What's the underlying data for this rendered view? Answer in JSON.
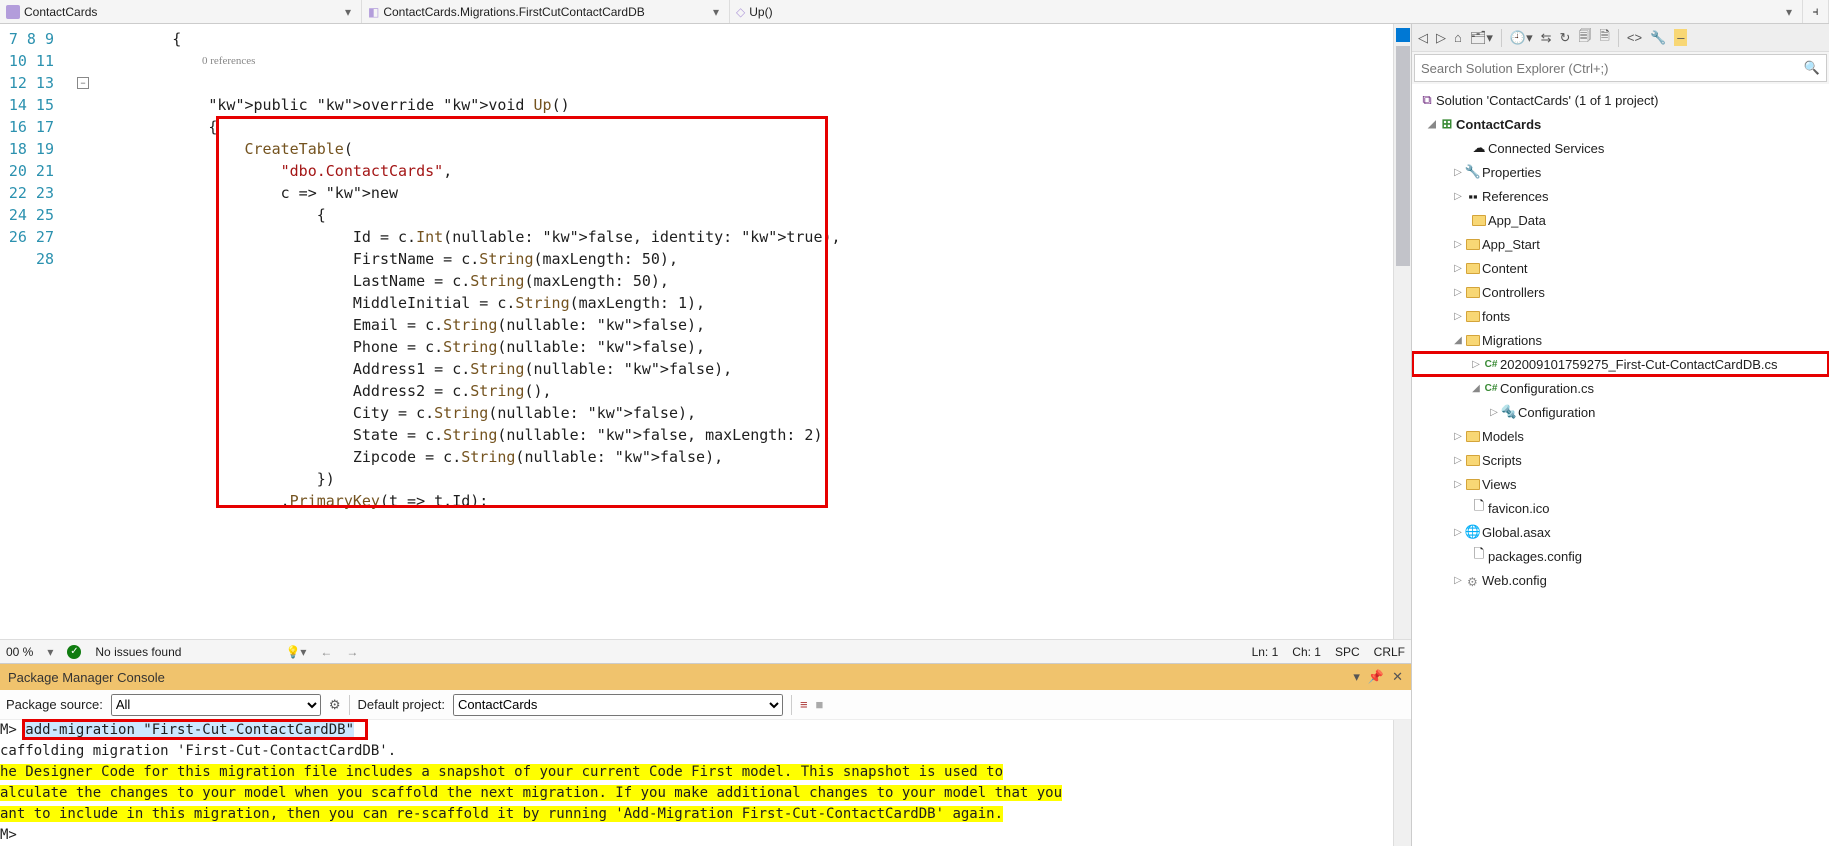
{
  "topbar": {
    "dd1": "ContactCards",
    "dd2": "ContactCards.Migrations.FirstCutContactCardDB",
    "dd3": "Up()"
  },
  "code": {
    "lens": "0 references",
    "lines": [
      "        {",
      "",
      "            public override void Up()",
      "            {",
      "                CreateTable(",
      "                    \"dbo.ContactCards\",",
      "                    c => new",
      "                        {",
      "                            Id = c.Int(nullable: false, identity: true),",
      "                            FirstName = c.String(maxLength: 50),",
      "                            LastName = c.String(maxLength: 50),",
      "                            MiddleInitial = c.String(maxLength: 1),",
      "                            Email = c.String(nullable: false),",
      "                            Phone = c.String(nullable: false),",
      "                            Address1 = c.String(nullable: false),",
      "                            Address2 = c.String(),",
      "                            City = c.String(nullable: false),",
      "                            State = c.String(nullable: false, maxLength: 2),",
      "                            Zipcode = c.String(nullable: false),",
      "                        })",
      "                    .PrimaryKey(t => t.Id);",
      ""
    ],
    "line_start": 7
  },
  "status": {
    "zoom": "00 %",
    "issues": "No issues found",
    "ln": "Ln: 1",
    "ch": "Ch: 1",
    "spc": "SPC",
    "crlf": "CRLF"
  },
  "pmc": {
    "title": "Package Manager Console",
    "pkg_src_label": "Package source:",
    "pkg_src_value": "All",
    "def_proj_label": "Default project:",
    "def_proj_value": "ContactCards",
    "cmd_prompt": "M>",
    "cmd_text": "add-migration \"First-Cut-ContactCardDB\"",
    "out1": "caffolding migration 'First-Cut-ContactCardDB'.",
    "out2": "he Designer Code for this migration file includes a snapshot of your current Code First model. This snapshot is used to",
    "out3": "alculate the changes to your model when you scaffold the next migration. If you make additional changes to your model that you",
    "out4": "ant to include in this migration, then you can re-scaffold it by running 'Add-Migration First-Cut-ContactCardDB' again.",
    "prompt2": "M>"
  },
  "se": {
    "search_placeholder": "Search Solution Explorer (Ctrl+;)",
    "sln": "Solution 'ContactCards' (1 of 1 project)",
    "proj": "ContactCards",
    "nodes": {
      "connected": "Connected Services",
      "properties": "Properties",
      "references": "References",
      "app_data": "App_Data",
      "app_start": "App_Start",
      "content": "Content",
      "controllers": "Controllers",
      "fonts": "fonts",
      "migrations": "Migrations",
      "migration_file": "202009101759275_First-Cut-ContactCardDB.cs",
      "config_cs": "Configuration.cs",
      "config_cls": "Configuration",
      "models": "Models",
      "scripts": "Scripts",
      "views": "Views",
      "favicon": "favicon.ico",
      "global_asax": "Global.asax",
      "packages": "packages.config",
      "webconfig": "Web.config"
    }
  }
}
